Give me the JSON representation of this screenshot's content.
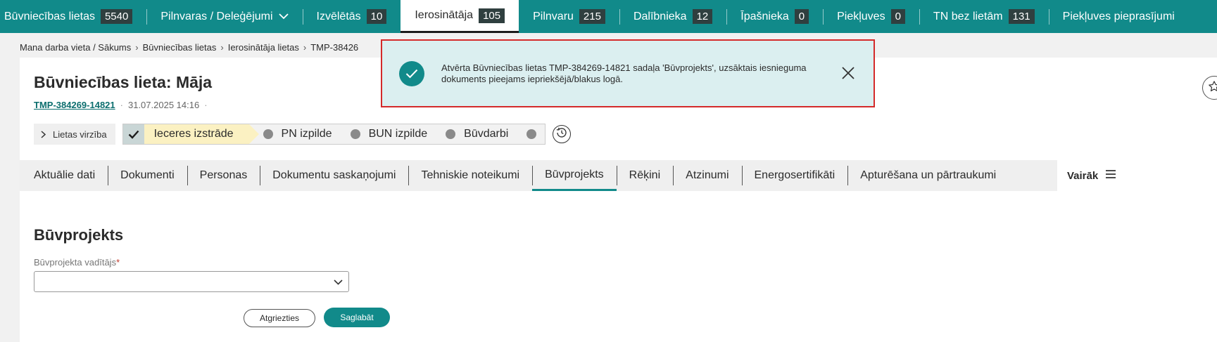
{
  "topnav": {
    "items": [
      {
        "label": "Būvniecības lietas",
        "count": "5540"
      },
      {
        "label": "Pilnvaras / Deleģējumi",
        "count": ""
      },
      {
        "label": "Izvēlētās",
        "count": "10"
      },
      {
        "label": "Ierosinātāja",
        "count": "105"
      },
      {
        "label": "Pilnvaru",
        "count": "215"
      },
      {
        "label": "Dalībnieka",
        "count": "12"
      },
      {
        "label": "Īpašnieka",
        "count": "0"
      },
      {
        "label": "Piekļuves",
        "count": "0"
      },
      {
        "label": "TN bez lietām",
        "count": "131"
      },
      {
        "label": "Piekļuves pieprasījumi",
        "count": ""
      }
    ]
  },
  "breadcrumb": [
    "Mana darba vieta / Sākums",
    "Būvniecības lietas",
    "Ierosinātāja lietas",
    "TMP-38426"
  ],
  "case": {
    "title": "Būvniecības lieta: Māja",
    "id": "TMP-384269-14821",
    "datetime": "31.07.2025 14:16"
  },
  "progress": {
    "toggle_label": "Lietas virzība",
    "steps": [
      "Ieceres izstrāde",
      "PN izpilde",
      "BUN izpilde",
      "Būvdarbi"
    ]
  },
  "tabs": [
    "Aktuālie dati",
    "Dokumenti",
    "Personas",
    "Dokumentu saskaņojumi",
    "Tehniskie noteikumi",
    "Būvprojekts",
    "Rēķini",
    "Atzinumi",
    "Energosertifikāti",
    "Apturēšana un pārtraukumi"
  ],
  "tabs_more": "Vairāk",
  "form": {
    "section_title": "Būvprojekts",
    "field_label": "Būvprojekta vadītājs",
    "required_mark": "*",
    "field_value": "",
    "back_button": "Atgriezties",
    "save_button": "Saglabāt"
  },
  "toast": {
    "message": "Atvērta Būvniecības lietas TMP-384269-14821 sadaļa 'Būvprojekts', uzsāktais iesnieguma dokuments pieejams iepriekšējā/blakus logā."
  },
  "colors": {
    "accent": "#118a8a",
    "badge": "#2f3f3f",
    "current_step": "#fbf1c2",
    "toast_bg": "#dbeff0",
    "toast_border": "#d42a2a"
  },
  "icons": {
    "nav_dropdown": "chevron-down-icon",
    "progress_toggle": "chevron-right-icon",
    "step_done": "check-icon",
    "history": "history-icon",
    "favorite": "star-icon",
    "more_menu": "menu-icon",
    "select": "chevron-down-icon",
    "toast_status": "check-circle-icon",
    "toast_close": "close-icon"
  }
}
